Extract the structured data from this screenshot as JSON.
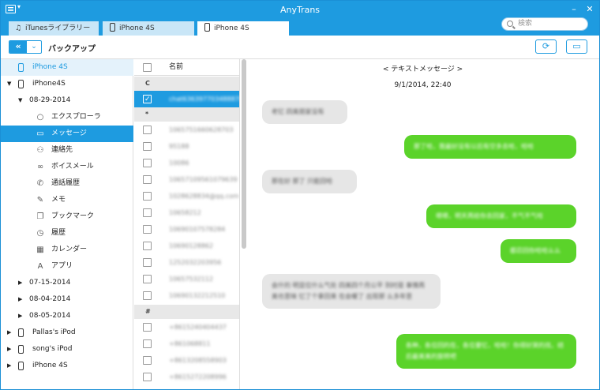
{
  "window": {
    "title": "AnyTrans",
    "minimize": "–",
    "close": "✕"
  },
  "tabs": [
    {
      "label": "iTunesライブラリー",
      "icon": "music-note-icon"
    },
    {
      "label": "iPhone 4S",
      "icon": "phone-icon"
    },
    {
      "label": "iPhone 4S",
      "icon": "phone-icon"
    }
  ],
  "search": {
    "placeholder": "検索"
  },
  "toolbar": {
    "title": "バックアップ",
    "back_glyph": "«",
    "dropdown_glyph": "⌄",
    "refresh_glyph": "⟳",
    "export_glyph": "▭"
  },
  "sidebar": {
    "header": "iPhone 4S",
    "device": "iPhone4S",
    "backups": [
      {
        "date": "08-29-2014",
        "expanded": true
      },
      {
        "date": "07-15-2014"
      },
      {
        "date": "08-04-2014"
      },
      {
        "date": "08-05-2014"
      }
    ],
    "categories": [
      {
        "label": "エクスプローラ",
        "icon": "search-icon",
        "glyph": "○"
      },
      {
        "label": "メッセージ",
        "icon": "message-icon",
        "glyph": "▭"
      },
      {
        "label": "連絡先",
        "icon": "contacts-icon",
        "glyph": "⚇"
      },
      {
        "label": "ボイスメール",
        "icon": "voicemail-icon",
        "glyph": "∞"
      },
      {
        "label": "通話履歴",
        "icon": "call-history-icon",
        "glyph": "✆"
      },
      {
        "label": "メモ",
        "icon": "notes-icon",
        "glyph": "✎"
      },
      {
        "label": "ブックマーク",
        "icon": "bookmark-icon",
        "glyph": "❐"
      },
      {
        "label": "履歴",
        "icon": "history-icon",
        "glyph": "◷"
      },
      {
        "label": "カレンダー",
        "icon": "calendar-icon",
        "glyph": "▦"
      },
      {
        "label": "アプリ",
        "icon": "apps-icon",
        "glyph": "A"
      }
    ],
    "devices": [
      {
        "label": "Pallas's iPod"
      },
      {
        "label": "song's iPod"
      },
      {
        "label": "iPhone 4S"
      }
    ]
  },
  "list": {
    "header": "名前",
    "groups": [
      {
        "label": "C",
        "items": [
          "chat636397703488870"
        ]
      },
      {
        "label": "*",
        "items": [
          "1065751660628703",
          "95188",
          "10086",
          "10657109561079639",
          "1028628834@qq.com",
          "10658212",
          "10690107578284",
          "10690128862",
          "1252032203956",
          "10657532112",
          "10690132212510"
        ]
      },
      {
        "label": "#",
        "items": [
          "+8615240404437",
          "+861068811",
          "+8613208558903",
          "+8615272208996"
        ]
      }
    ]
  },
  "conversation": {
    "title": "< テキストメッセージ >",
    "date": "9/1/2014, 22:40",
    "messages": [
      {
        "dir": "in",
        "text": "老忆 四美朋家没有"
      },
      {
        "dir": "out",
        "text": "那了哈，我最好没有以后有空多去哈，哈哈"
      },
      {
        "dir": "in",
        "text": "那在好 那了 只能回哈"
      },
      {
        "dir": "out",
        "text": "嗯嗯，明天再给你去回家，不气不气哈"
      },
      {
        "dir": "out",
        "text": "都忍回你哈哈么么"
      },
      {
        "dir": "in",
        "text": "会什的 明显位什么气处 四美四个月公平 到时是 事情再美也意味 忆了个拿回来 在会暖了 出现那 么多年意"
      },
      {
        "dir": "out",
        "text": "各种，各位回的在，各位要忆，哈哈！你得好哭的找，结后最美美的旋转吧"
      }
    ]
  }
}
